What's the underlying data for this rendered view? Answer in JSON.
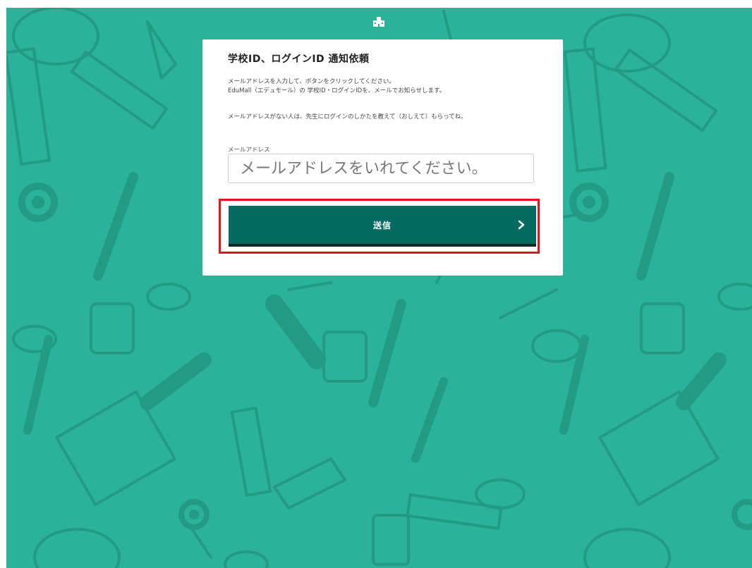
{
  "colors": {
    "background": "#2bb39a",
    "pattern": "#229a84",
    "card": "#ffffff",
    "button": "#036b62",
    "button_shadow": "#052926",
    "highlight": "#e8121b"
  },
  "header": {
    "icon": "school-building-icon"
  },
  "form": {
    "title": "学校ID、ログインID 通知依頼",
    "description_line1": "メールアドレスを入力して、ボタンをクリックしてください。",
    "description_line2": "EduMall（エデュモール）の 学校ID・ログインIDを、メールでお知らせします。",
    "description_line3": "メールアドレスがない人は、先生にログインのしかたを教えて（おしえて）もらってね。",
    "email_label": "メールアドレス",
    "email_value": "",
    "email_placeholder": "メールアドレスをいれてください。",
    "submit_label": "送信",
    "submit_icon": "chevron-right-icon"
  }
}
